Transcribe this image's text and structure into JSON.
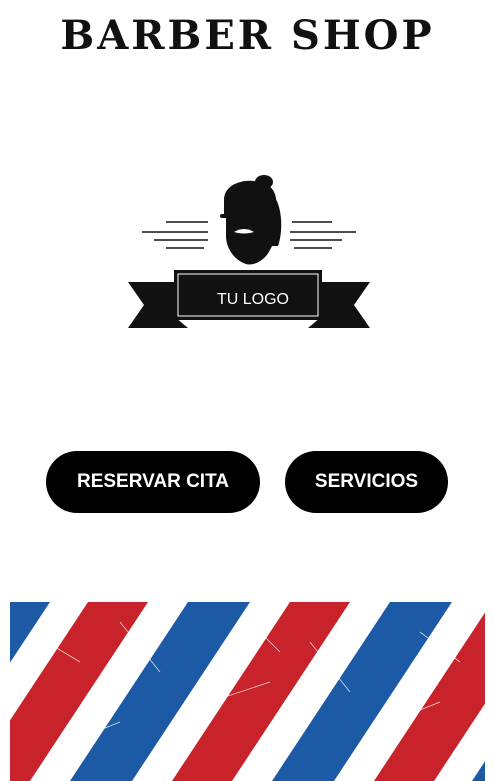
{
  "header": {
    "title": "BARBER SHOP"
  },
  "logo": {
    "text": "TU LOGO",
    "icon": "bearded-man-icon"
  },
  "buttons": {
    "reserve_label": "RESERVAR CITA",
    "services_label": "SERVICIOS"
  },
  "banner": {
    "pattern": "barber-pole-stripes",
    "colors": [
      "#c8222a",
      "#ffffff",
      "#1c5aa6"
    ]
  }
}
